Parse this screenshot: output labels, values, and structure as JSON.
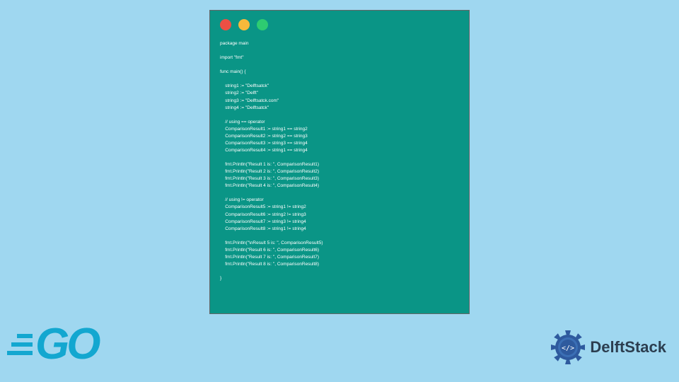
{
  "code": "package main\n\nimport \"fmt\"\n\nfunc main() {\n\n    string1 := \"Delftsatck\"\n    string2 := \"Delft\"\n    string3 := \"Delftsatck.com\"\n    string4 := \"Delftsatck\"\n\n    // using == operator\n    ComparisonResult1 := string1 == string2\n    ComparisonResult2 := string2 == string3\n    ComparisonResult3 := string3 == string4\n    ComparisonResult4 := string1 == string4\n\n    fmt.Println(\"Result 1 is: \", ComparisonResult1)\n    fmt.Println(\"Result 2 is: \", ComparisonResult2)\n    fmt.Println(\"Result 3 is: \", ComparisonResult3)\n    fmt.Println(\"Result 4 is: \", ComparisonResult4)\n\n    // using != operator\n    ComparisonResult5 := string1 != string2\n    ComparisonResult6 := string2 != string3\n    ComparisonResult7 := string3 != string4\n    ComparisonResult8 := string1 != string4\n\n    fmt.Println(\"\\nResult 5 is: \", ComparisonResult5)\n    fmt.Println(\"Result 6 is: \", ComparisonResult6)\n    fmt.Println(\"Result 7 is: \", ComparisonResult7)\n    fmt.Println(\"Result 8 is: \", ComparisonResult8)\n\n}",
  "go_logo_text": "GO",
  "delft_logo_text": "DelftStack"
}
